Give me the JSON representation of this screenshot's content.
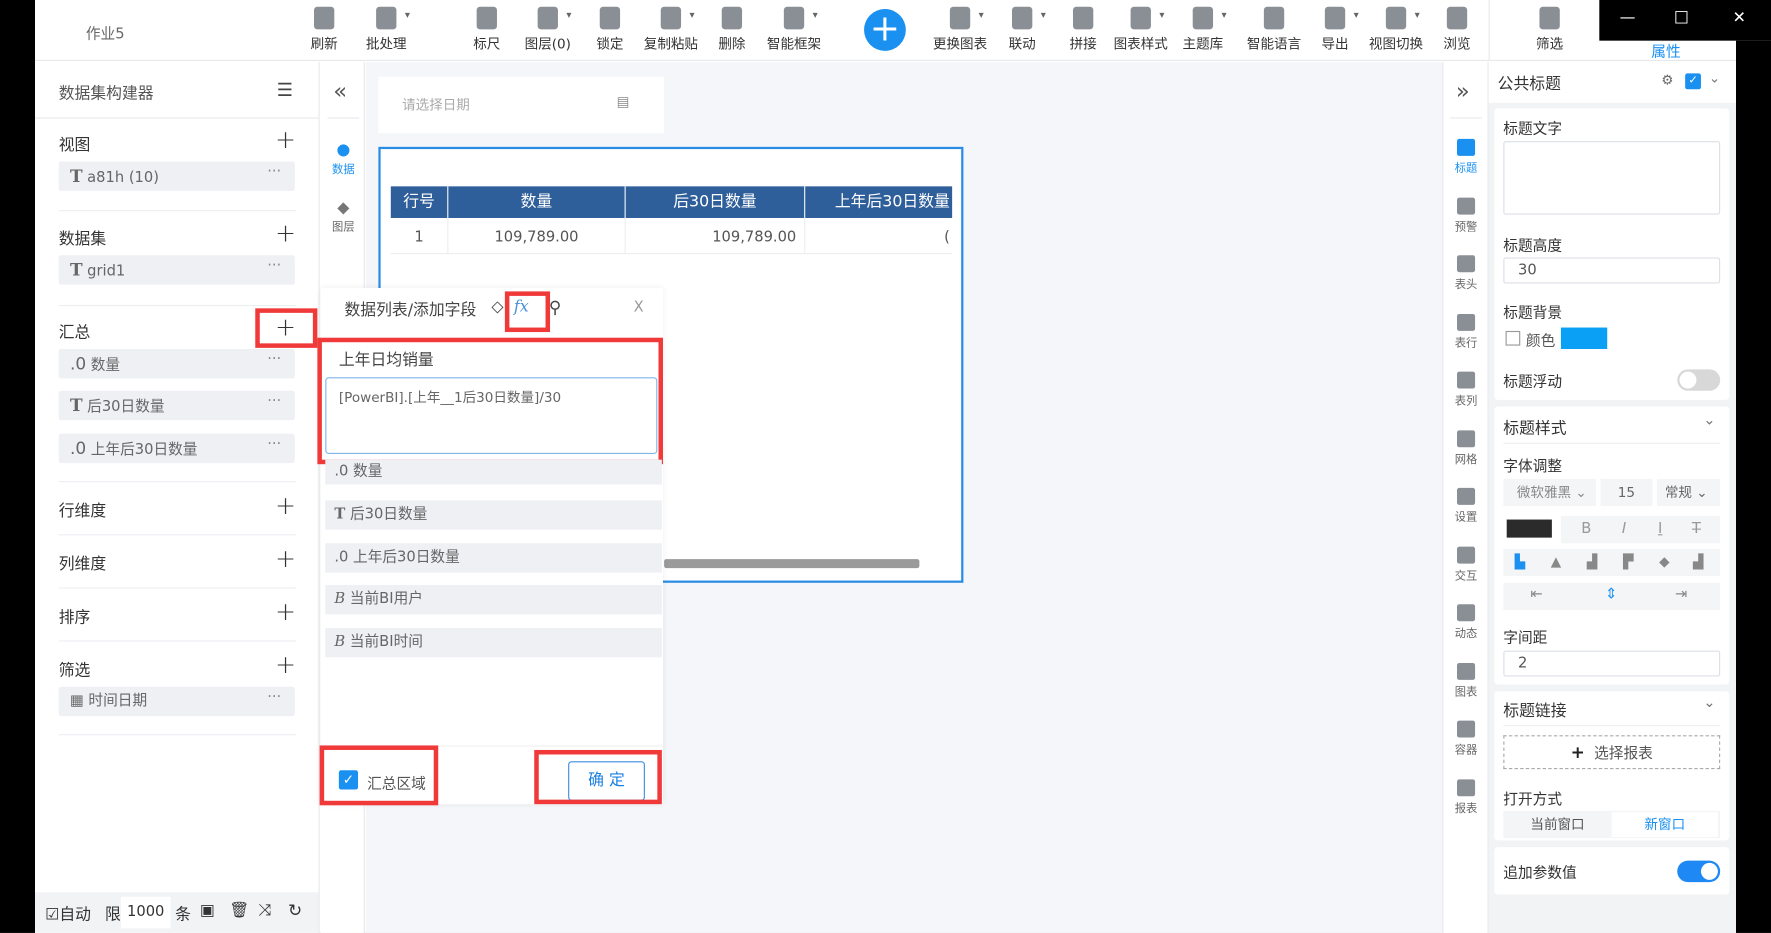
{
  "window": {
    "title": "作业5",
    "min": "—",
    "max": "☐",
    "close": "✕"
  },
  "toolbar": [
    {
      "label": "刷新",
      "icon": "refresh-icon"
    },
    {
      "label": "批处理",
      "icon": "batch-icon"
    },
    {
      "label": "标尺",
      "icon": "ruler-icon"
    },
    {
      "label": "图层(0)",
      "icon": "layers-icon"
    },
    {
      "label": "锁定",
      "icon": "lock-icon"
    },
    {
      "label": "复制粘贴",
      "icon": "copy-paste-icon"
    },
    {
      "label": "删除",
      "icon": "trash-icon"
    },
    {
      "label": "智能框架",
      "icon": "smart-frame-icon"
    },
    {
      "label": "更换图表",
      "icon": "change-chart-icon"
    },
    {
      "label": "联动",
      "icon": "link-icon"
    },
    {
      "label": "拼接",
      "icon": "stitch-icon"
    },
    {
      "label": "图表样式",
      "icon": "chart-style-icon"
    },
    {
      "label": "主题库",
      "icon": "theme-icon"
    },
    {
      "label": "智能语言",
      "icon": "microphone-icon"
    },
    {
      "label": "导出",
      "icon": "export-icon"
    },
    {
      "label": "视图切换",
      "icon": "view-switch-icon"
    },
    {
      "label": "浏览",
      "icon": "eye-icon"
    },
    {
      "label": "筛选",
      "icon": "filter-icon"
    }
  ],
  "add_label": "+",
  "properties_tab": "属性",
  "left": {
    "title": "数据集构建器",
    "sections": {
      "view": {
        "label": "视图",
        "items": [
          {
            "type": "T",
            "name": "a81h (10)"
          }
        ]
      },
      "dataset": {
        "label": "数据集",
        "items": [
          {
            "type": "T",
            "name": "grid1"
          }
        ]
      },
      "summary": {
        "label": "汇总",
        "items": [
          {
            "type": ".0",
            "name": "数量"
          },
          {
            "type": "T",
            "name": "后30日数量"
          },
          {
            "type": ".0",
            "name": "上年后30日数量"
          }
        ]
      },
      "row_dim": {
        "label": "行维度"
      },
      "col_dim": {
        "label": "列维度"
      },
      "sort": {
        "label": "排序"
      },
      "filter": {
        "label": "筛选",
        "items": [
          {
            "type": "calendar",
            "name": "时间日期"
          }
        ]
      }
    },
    "more": "···",
    "footer": {
      "auto": "自动",
      "limit": "限",
      "limit_value": "1000",
      "unit": "条"
    }
  },
  "side_icons": [
    {
      "label": "数据"
    },
    {
      "label": "图层"
    }
  ],
  "canvas": {
    "date_placeholder": "请选择日期",
    "table": {
      "headers": [
        "行号",
        "数量",
        "后30日数量",
        "上年后30日数量"
      ],
      "rows": [
        [
          "1",
          "109,789.00",
          "109,789.00",
          "("
        ]
      ]
    }
  },
  "popup": {
    "title": "数据列表/添加字段",
    "fx": "fx",
    "close": "X",
    "field_name": "上年日均销量",
    "formula": "[PowerBI].[上年__1后30日数量]/30",
    "fields": [
      {
        "type": ".0",
        "name": "数量"
      },
      {
        "type": "T",
        "name": "后30日数量"
      },
      {
        "type": ".0",
        "name": "上年后30日数量"
      },
      {
        "type": "B",
        "name": "当前BI用户"
      },
      {
        "type": "B",
        "name": "当前BI时间"
      }
    ],
    "summary_area": "汇总区域",
    "confirm": "确 定"
  },
  "right_icons": [
    {
      "label": "标题"
    },
    {
      "label": "预警"
    },
    {
      "label": "表头"
    },
    {
      "label": "表行"
    },
    {
      "label": "表列"
    },
    {
      "label": "网格"
    },
    {
      "label": "设置"
    },
    {
      "label": "交互"
    },
    {
      "label": "动态"
    },
    {
      "label": "图表"
    },
    {
      "label": "容器"
    },
    {
      "label": "报表"
    }
  ],
  "props": {
    "section_title": "公共标题",
    "title_text_label": "标题文字",
    "title_text": "",
    "title_height_label": "标题高度",
    "title_height": "30",
    "title_bg_label": "标题背景",
    "color_label": "颜色",
    "bg_color": "#0aa0f5",
    "float_label": "标题浮动",
    "style_label": "标题样式",
    "font_adjust_label": "字体调整",
    "font": "微软雅黑",
    "font_size": "15",
    "font_weight": "常规",
    "bold": "B",
    "italic": "I",
    "underline": "I",
    "strike": "T",
    "letter_spacing_label": "字间距",
    "letter_spacing": "2",
    "link_label": "标题链接",
    "select_report": "选择报表",
    "open_mode_label": "打开方式",
    "open_current": "当前窗口",
    "open_new": "新窗口",
    "append_param_label": "追加参数值"
  }
}
